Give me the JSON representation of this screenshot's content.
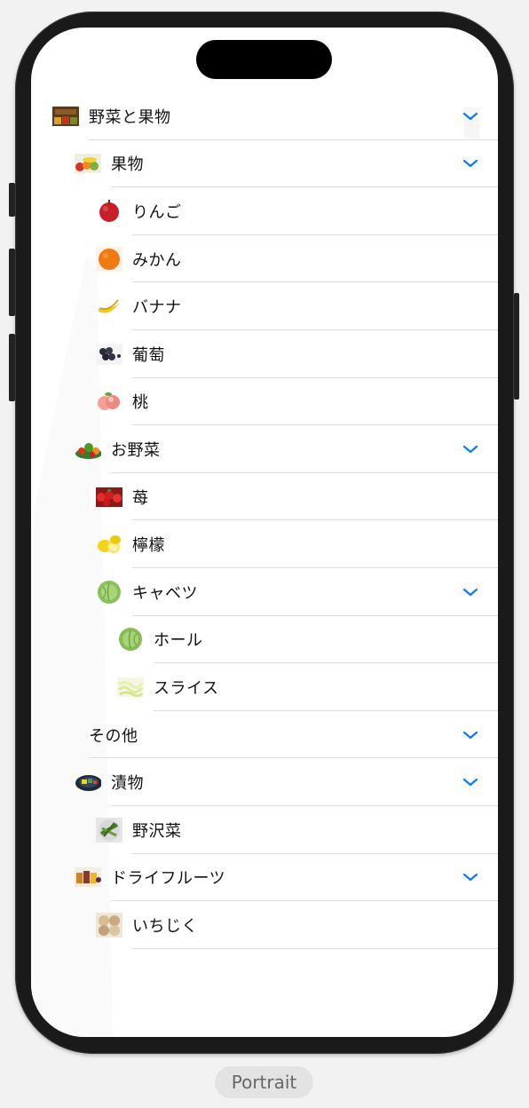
{
  "items": [
    {
      "label": "野菜と果物",
      "icon": "vegetable-stand-thumbnail",
      "expanded": true
    },
    {
      "label": "果物",
      "icon": "fruit-basket-thumbnail",
      "expanded": true
    },
    {
      "label": "りんご",
      "icon": "apple-thumbnail"
    },
    {
      "label": "みかん",
      "icon": "orange-thumbnail"
    },
    {
      "label": "バナナ",
      "icon": "banana-thumbnail"
    },
    {
      "label": "葡萄",
      "icon": "grape-thumbnail"
    },
    {
      "label": "桃",
      "icon": "peach-thumbnail"
    },
    {
      "label": "お野菜",
      "icon": "vegetables-thumbnail",
      "expanded": true
    },
    {
      "label": "苺",
      "icon": "strawberry-thumbnail"
    },
    {
      "label": "檸檬",
      "icon": "lemon-thumbnail"
    },
    {
      "label": "キャベツ",
      "icon": "cabbage-thumbnail",
      "expanded": true
    },
    {
      "label": "ホール",
      "icon": "cabbage-whole-thumbnail"
    },
    {
      "label": "スライス",
      "icon": "cabbage-slice-thumbnail"
    },
    {
      "label": "その他",
      "icon": "",
      "expanded": true
    },
    {
      "label": "漬物",
      "icon": "pickles-thumbnail",
      "expanded": true
    },
    {
      "label": "野沢菜",
      "icon": "nozawana-thumbnail"
    },
    {
      "label": "ドライフルーツ",
      "icon": "dried-fruit-thumbnail",
      "expanded": true
    },
    {
      "label": "いちじく",
      "icon": "fig-thumbnail"
    }
  ],
  "caption": "Portrait",
  "colors": {
    "accent": "#0a7aff",
    "separator": "#dcdcdc",
    "text": "#111111"
  }
}
